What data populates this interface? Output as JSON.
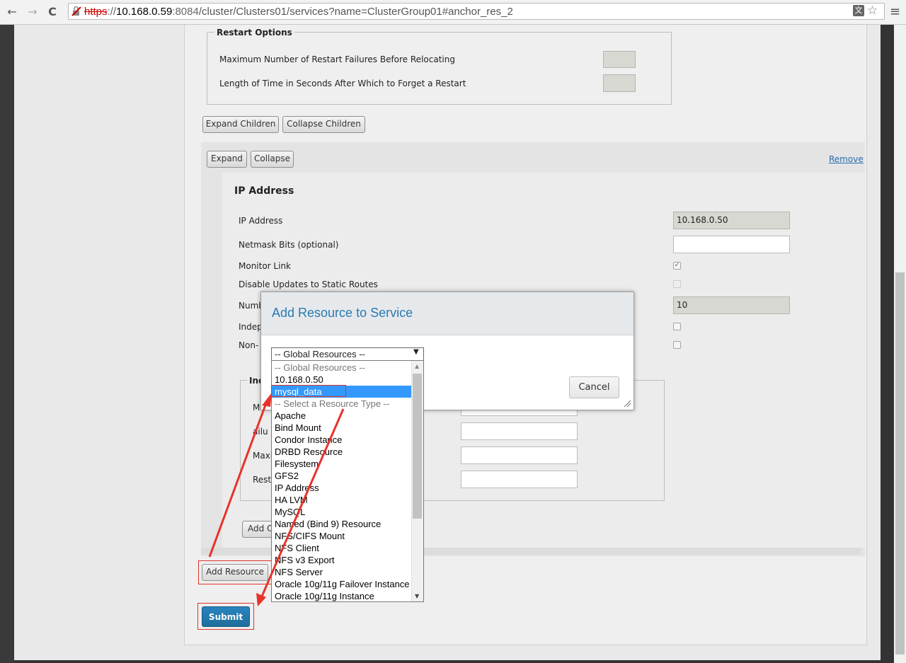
{
  "browser": {
    "url_protocol": "https",
    "url_sep": "://",
    "url_host": "10.168.0.59",
    "url_port": ":8084",
    "url_path": "/cluster/Clusters01/services?name=ClusterGroup01#anchor_res_2",
    "nav_back": "←",
    "nav_forward": "→",
    "nav_reload": "C",
    "translate_icon": "文",
    "star_icon": "☆",
    "menu_icon": "≡"
  },
  "restart_options": {
    "legend": "Restart Options",
    "max_failures_label": "Maximum Number of Restart Failures Before Relocating",
    "forget_label": "Length of Time in Seconds After Which to Forget a Restart"
  },
  "buttons": {
    "expand_children": "Expand Children",
    "collapse_children": "Collapse Children",
    "expand": "Expand",
    "collapse": "Collapse",
    "remove": "Remove",
    "add_resource": "Add Resource",
    "submit": "Submit",
    "add_child_partial": "Add C",
    "cancel": "Cancel"
  },
  "ip_resource": {
    "heading": "IP Address",
    "rows": [
      {
        "label": "IP Address",
        "value": "10.168.0.50"
      },
      {
        "label": "Netmask Bits (optional)",
        "value": ""
      },
      {
        "label": "Monitor Link",
        "checked": true
      },
      {
        "label": "Disable Updates to Static Routes",
        "checked": false
      },
      {
        "label": "Numb",
        "value": "10"
      },
      {
        "label": "Indep",
        "checked": false
      },
      {
        "label": "Non-",
        "checked": false
      }
    ],
    "sub_legend_partial": "Inc",
    "sub_labels": [
      "M",
      "ailu",
      "Maxi",
      "Resta"
    ]
  },
  "modal": {
    "title": "Add Resource to Service",
    "select_value": "-- Global Resources --",
    "options": [
      {
        "label": "-- Global Resources --",
        "kind": "header"
      },
      {
        "label": "10.168.0.50",
        "kind": "item"
      },
      {
        "label": "mysql_data",
        "kind": "selected"
      },
      {
        "label": "-- Select a Resource Type --",
        "kind": "header"
      },
      {
        "label": "Apache",
        "kind": "item"
      },
      {
        "label": "Bind Mount",
        "kind": "item"
      },
      {
        "label": "Condor Instance",
        "kind": "item"
      },
      {
        "label": "DRBD Resource",
        "kind": "item"
      },
      {
        "label": "Filesystem",
        "kind": "item"
      },
      {
        "label": "GFS2",
        "kind": "item"
      },
      {
        "label": "IP Address",
        "kind": "item"
      },
      {
        "label": "HA LVM",
        "kind": "item"
      },
      {
        "label": "MySQL",
        "kind": "item"
      },
      {
        "label": "Named (Bind 9) Resource",
        "kind": "item"
      },
      {
        "label": "NFS/CIFS Mount",
        "kind": "item"
      },
      {
        "label": "NFS Client",
        "kind": "item"
      },
      {
        "label": "NFS v3 Export",
        "kind": "item"
      },
      {
        "label": "NFS Server",
        "kind": "item"
      },
      {
        "label": "Oracle 10g/11g Failover Instance",
        "kind": "item"
      },
      {
        "label": "Oracle 10g/11g Instance",
        "kind": "item"
      }
    ]
  },
  "colors": {
    "annotation_red": "#e0332b",
    "submit_blue": "#1f6e9c",
    "link_blue": "#2a6cb0",
    "selected_option": "#3399ff"
  }
}
